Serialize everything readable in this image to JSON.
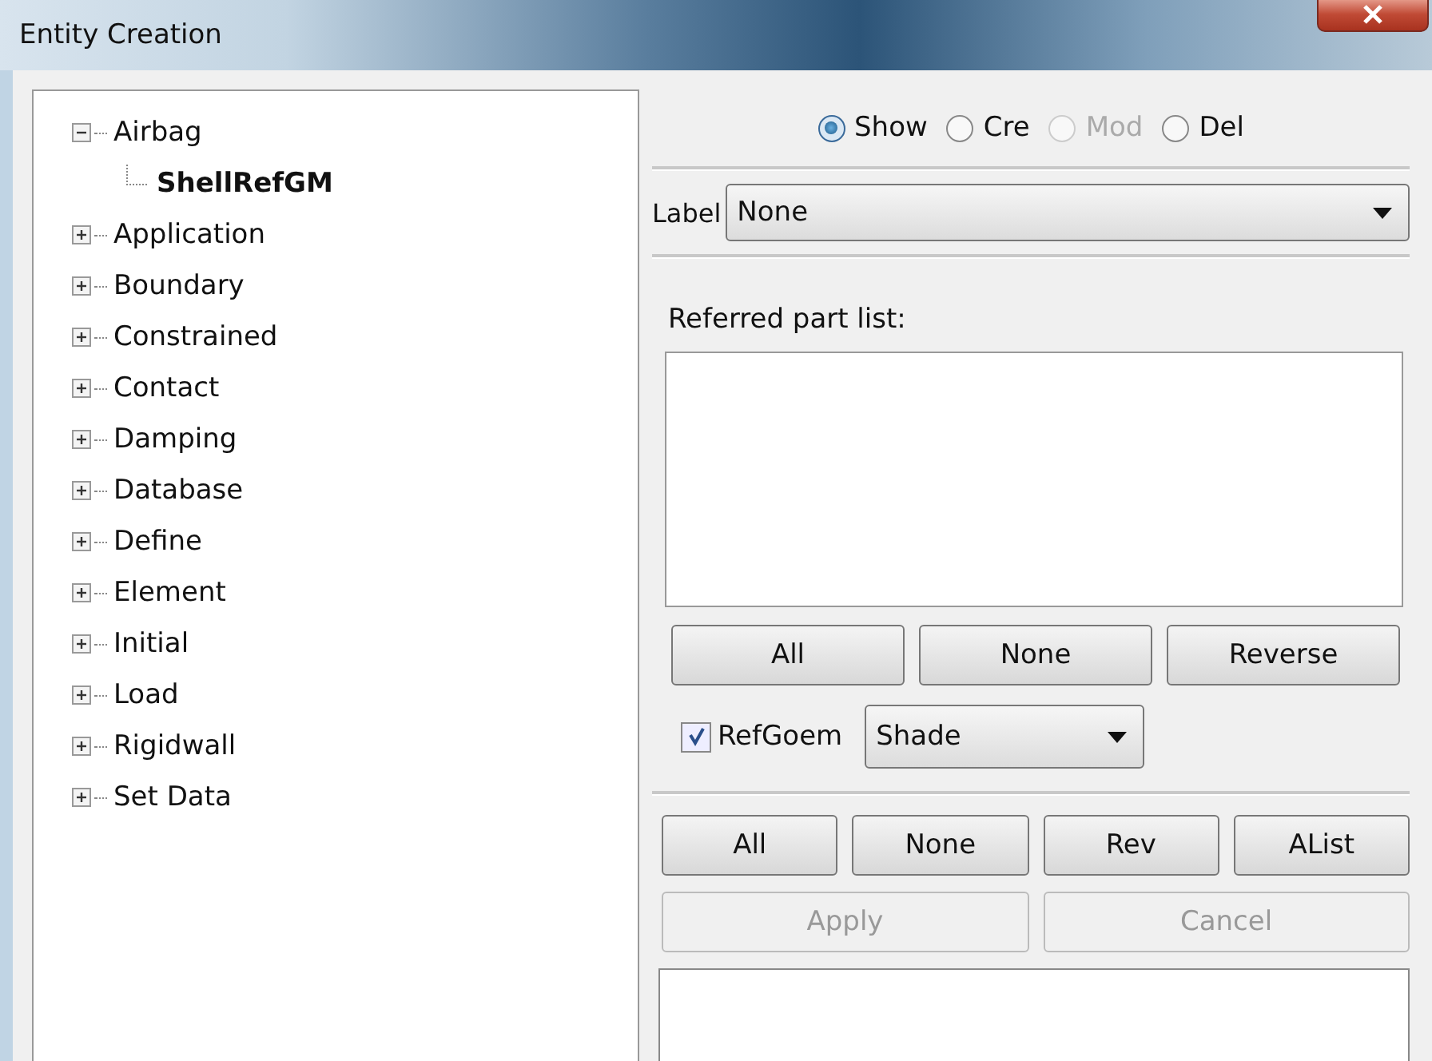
{
  "window": {
    "title": "Entity Creation"
  },
  "tree": [
    {
      "label": "Airbag",
      "expanded": true,
      "selected": false,
      "children": [
        {
          "label": "ShellRefGM",
          "selected": true
        }
      ]
    },
    {
      "label": "Application",
      "expanded": false,
      "selected": false
    },
    {
      "label": "Boundary",
      "expanded": false,
      "selected": false
    },
    {
      "label": "Constrained",
      "expanded": false,
      "selected": false
    },
    {
      "label": "Contact",
      "expanded": false,
      "selected": false
    },
    {
      "label": "Damping",
      "expanded": false,
      "selected": false
    },
    {
      "label": "Database",
      "expanded": false,
      "selected": false
    },
    {
      "label": "Define",
      "expanded": false,
      "selected": false
    },
    {
      "label": "Element",
      "expanded": false,
      "selected": false
    },
    {
      "label": "Initial",
      "expanded": false,
      "selected": false
    },
    {
      "label": "Load",
      "expanded": false,
      "selected": false
    },
    {
      "label": "Rigidwall",
      "expanded": false,
      "selected": false
    },
    {
      "label": "Set Data",
      "expanded": false,
      "selected": false
    }
  ],
  "modes": [
    {
      "label": "Show",
      "selected": true,
      "disabled": false
    },
    {
      "label": "Cre",
      "selected": false,
      "disabled": false
    },
    {
      "label": "Mod",
      "selected": false,
      "disabled": true
    },
    {
      "label": "Del",
      "selected": false,
      "disabled": false
    }
  ],
  "label_select": {
    "label": "Label",
    "value": "None"
  },
  "referred_list": {
    "title": "Referred part list:"
  },
  "list_buttons": [
    "All",
    "None",
    "Reverse"
  ],
  "ref_geom": {
    "label": "RefGoem",
    "checked": true,
    "display": "Shade"
  },
  "select_buttons": [
    "All",
    "None",
    "Rev",
    "AList"
  ],
  "actions": [
    {
      "label": "Apply",
      "disabled": true
    },
    {
      "label": "Cancel",
      "disabled": true
    }
  ]
}
